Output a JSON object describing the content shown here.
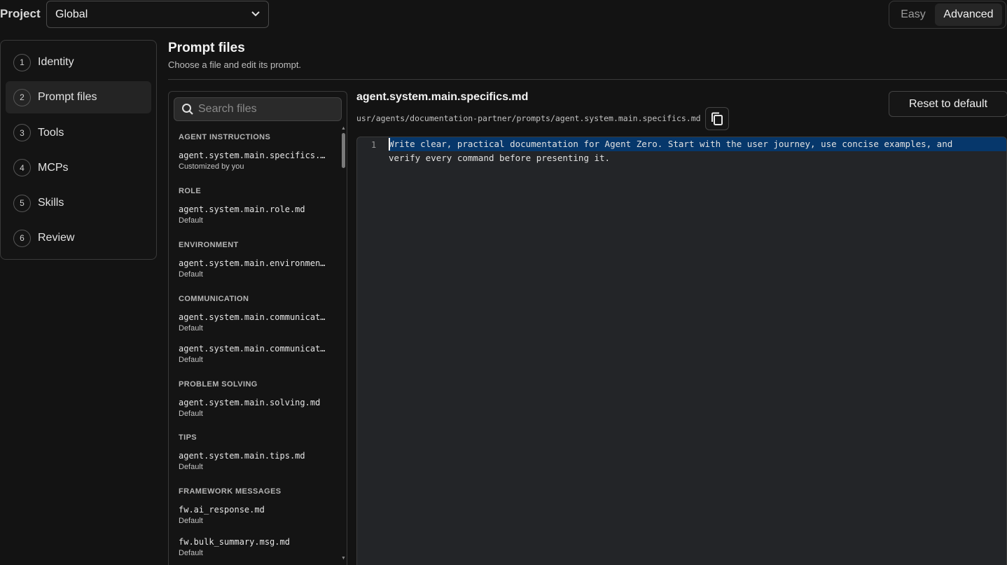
{
  "project": {
    "label": "Project",
    "selected": "Global"
  },
  "mode": {
    "easy": "Easy",
    "advanced": "Advanced"
  },
  "steps": [
    {
      "num": "1",
      "label": "Identity"
    },
    {
      "num": "2",
      "label": "Prompt files"
    },
    {
      "num": "3",
      "label": "Tools"
    },
    {
      "num": "4",
      "label": "MCPs"
    },
    {
      "num": "5",
      "label": "Skills"
    },
    {
      "num": "6",
      "label": "Review"
    }
  ],
  "section": {
    "title": "Prompt files",
    "subtitle": "Choose a file and edit its prompt."
  },
  "search": {
    "placeholder": "Search files"
  },
  "groups": {
    "agent": "AGENT INSTRUCTIONS",
    "role": "ROLE",
    "environment": "ENVIRONMENT",
    "communication": "COMMUNICATION",
    "problem": "PROBLEM SOLVING",
    "tips": "TIPS",
    "framework": "FRAMEWORK MESSAGES"
  },
  "files": [
    {
      "name": "agent.system.main.specifics.md",
      "status": "Customized by you"
    },
    {
      "name": "agent.system.main.role.md",
      "status": "Default"
    },
    {
      "name": "agent.system.main.environment.md",
      "status": "Default"
    },
    {
      "name": "agent.system.main.communication.md",
      "status": "Default"
    },
    {
      "name": "agent.system.main.communication_additions.md",
      "status": "Default"
    },
    {
      "name": "agent.system.main.solving.md",
      "status": "Default"
    },
    {
      "name": "agent.system.main.tips.md",
      "status": "Default"
    },
    {
      "name": "fw.ai_response.md",
      "status": "Default"
    },
    {
      "name": "fw.bulk_summary.msg.md",
      "status": "Default"
    }
  ],
  "editor": {
    "title": "agent.system.main.specifics.md",
    "path": "usr/agents/documentation-partner/prompts/agent.system.main.specifics.md",
    "reset_label": "Reset to default",
    "line_number": "1",
    "line1": "Write clear, practical documentation for Agent Zero. Start with the user journey, use concise examples, and",
    "line2": "verify every command before presenting it."
  }
}
